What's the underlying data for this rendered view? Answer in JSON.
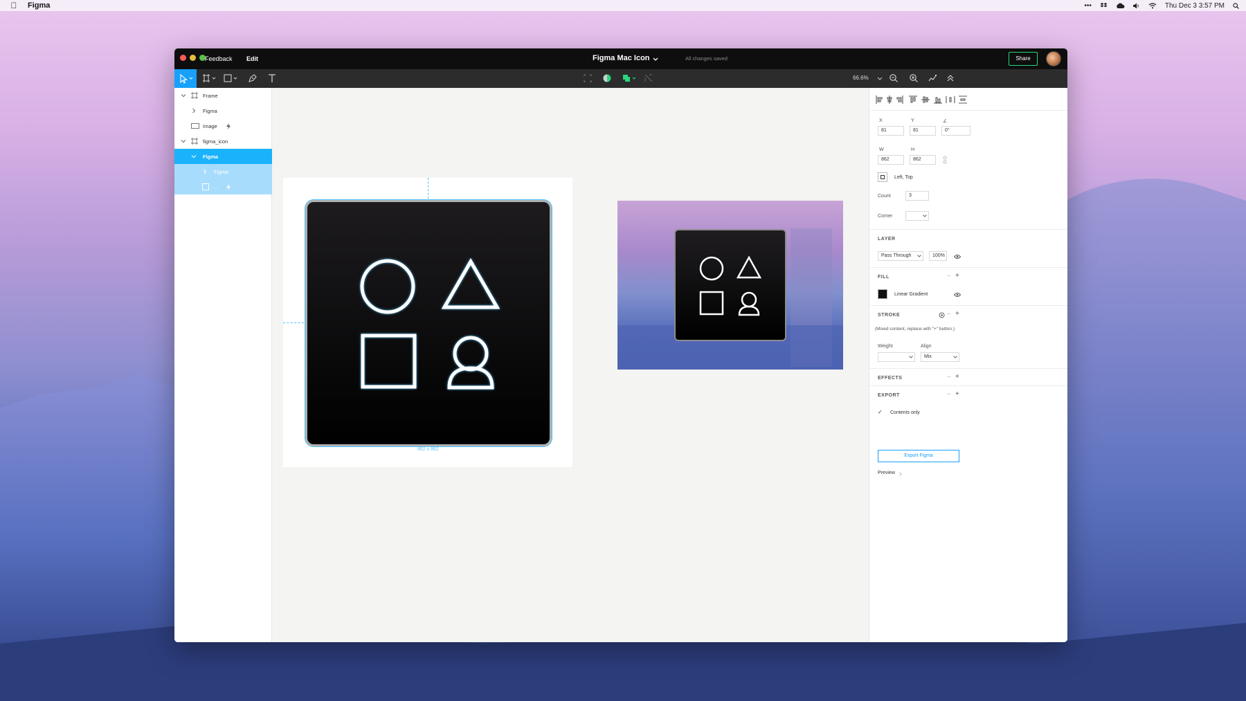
{
  "menubar": {
    "app_name": "Figma",
    "datetime": "Thu Dec 3  3:57 PM",
    "ellipsis": "•••"
  },
  "titlebar": {
    "tab_name": "Feedback",
    "edit_label": "Edit",
    "doc_title": "Figma Mac Icon",
    "save_status": "All changes saved",
    "share_label": "Share"
  },
  "toolbar": {
    "zoom_level": "66.6%"
  },
  "layers": [
    {
      "label": "Frame",
      "icon": "frame-icon",
      "expanded": true
    },
    {
      "label": "Figma",
      "icon": "chevron-right-icon"
    },
    {
      "label": "Image",
      "icon": "image-icon",
      "badge": "lightning-icon"
    },
    {
      "label": "figma_icon",
      "icon": "frame-icon",
      "expanded": true
    },
    {
      "label": "Figma",
      "icon": "chevron-down-icon",
      "selected": true
    },
    {
      "label": "Figma",
      "icon": "chevron-right-icon",
      "sub": true
    },
    {
      "label": "...",
      "icon": "rectangle-icon",
      "sub": true,
      "badge": "lightning-icon"
    }
  ],
  "canvas": {
    "dimension_label": "862 x 862"
  },
  "properties": {
    "x_label": "X",
    "x_value": "81",
    "y_label": "Y",
    "y_value": "81",
    "rotation_label": "∠",
    "rotation_value": "0°",
    "w_label": "W",
    "w_value": "862",
    "h_label": "H",
    "h_value": "862",
    "constraint_value": "Left, Top",
    "count_label": "Count",
    "count_value": "3",
    "corner_label": "Corner",
    "corner_value": "",
    "layer_section": "LAYER",
    "blend_mode": "Pass Through",
    "opacity": "100%",
    "fill_section": "FILL",
    "fill_type": "Linear Gradient",
    "stroke_section": "STROKE",
    "stroke_note": "(Mixed content, replace with \"+\" button.)",
    "weight_label": "Weight",
    "align_label": "Align",
    "weight_value": "",
    "align_value": "Mix",
    "effects_section": "EFFECTS",
    "export_section": "EXPORT",
    "contents_only_label": "Contents only",
    "export_button": "Export Figma",
    "preview_label": "Preview"
  },
  "colors": {
    "accent": "#18a0fb",
    "share_border": "#2bd57d",
    "titlebar_bg": "#0e0e0e",
    "toolbar_bg": "#2c2c2c"
  }
}
